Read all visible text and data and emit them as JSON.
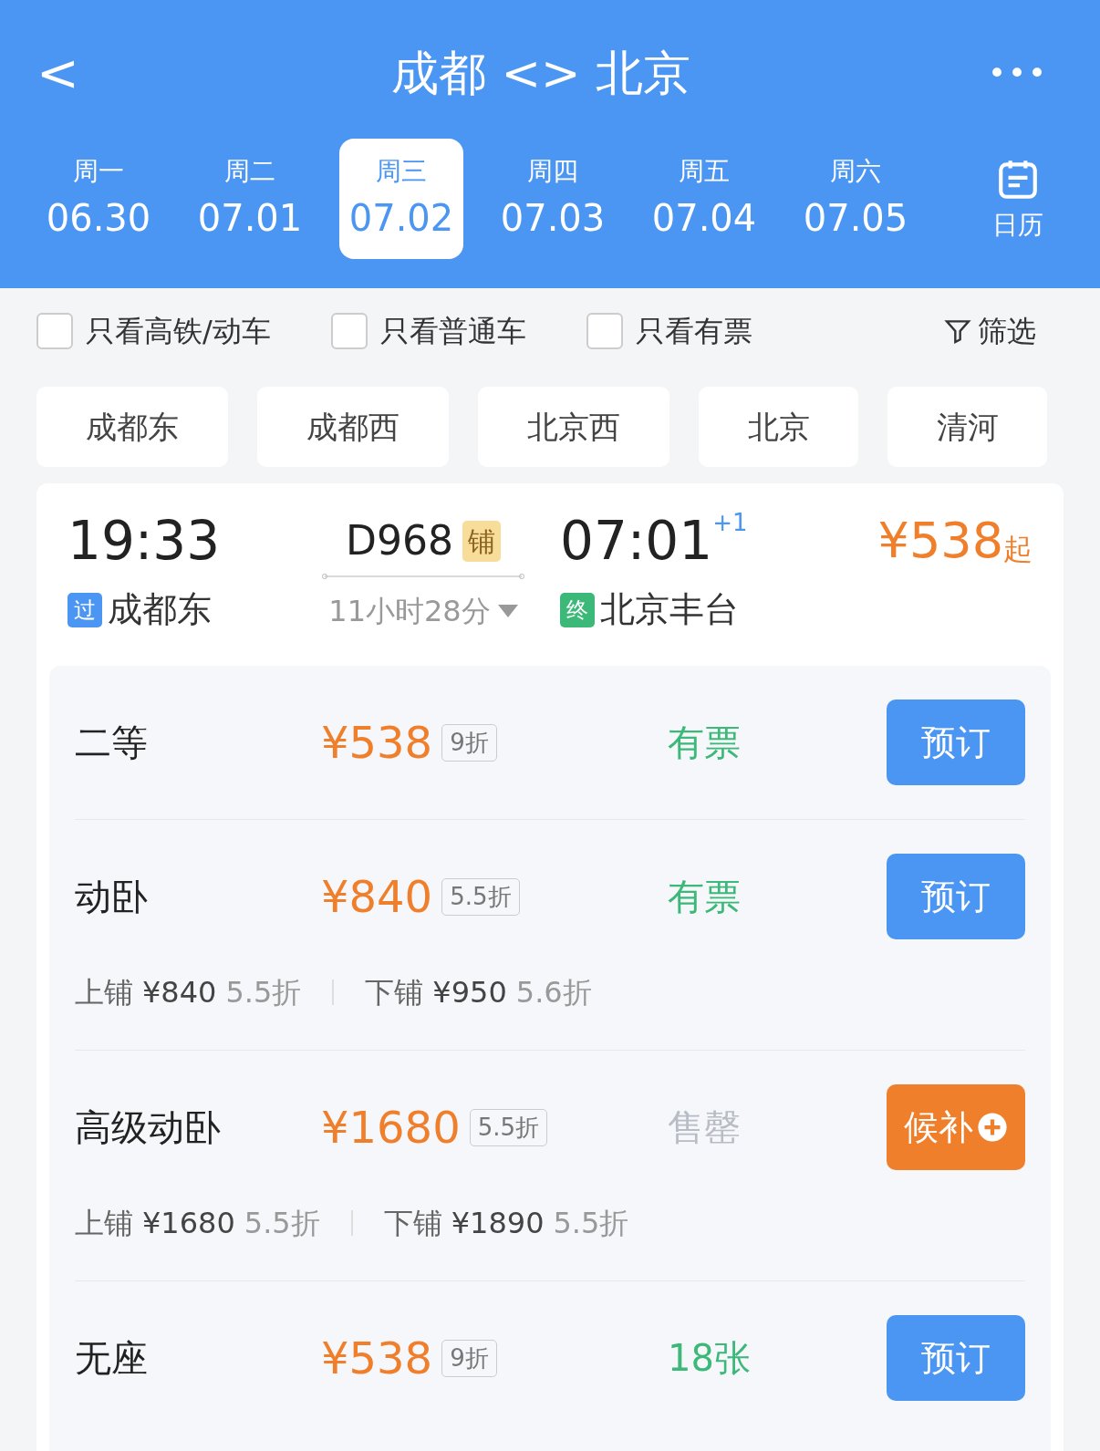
{
  "header": {
    "back": "<",
    "title": "成都 <> 北京",
    "more": "•••"
  },
  "dates": [
    {
      "day": "周一",
      "date": "06.30",
      "selected": false
    },
    {
      "day": "周二",
      "date": "07.01",
      "selected": false
    },
    {
      "day": "周三",
      "date": "07.02",
      "selected": true
    },
    {
      "day": "周四",
      "date": "07.03",
      "selected": false
    },
    {
      "day": "周五",
      "date": "07.04",
      "selected": false
    },
    {
      "day": "周六",
      "date": "07.05",
      "selected": false
    }
  ],
  "calendar": {
    "label": "日历"
  },
  "filters": [
    {
      "label": "只看高铁/动车",
      "checked": false
    },
    {
      "label": "只看普通车",
      "checked": false
    },
    {
      "label": "只看有票",
      "checked": false
    }
  ],
  "filter_button": "筛选",
  "stations": [
    {
      "label": "成都东",
      "selected": false
    },
    {
      "label": "成都西",
      "selected": false
    },
    {
      "label": "北京西",
      "selected": false
    },
    {
      "label": "北京",
      "selected": false
    },
    {
      "label": "清河",
      "selected": false
    }
  ],
  "train": {
    "depart_time": "19:33",
    "number": "D968",
    "type_badge": "铺",
    "arrive_time": "07:01",
    "day_offset": "+1",
    "price": "¥538",
    "price_suffix": "起",
    "depart_tag": "过",
    "depart_station": "成都东",
    "duration": "11小时28分",
    "arrive_tag": "终",
    "arrive_station": "北京丰台"
  },
  "seats": [
    {
      "name": "二等",
      "price": "¥538",
      "discount": "9折",
      "status": {
        "label": "有票",
        "kind": "available"
      },
      "action": {
        "label": "预订",
        "kind": "book"
      }
    },
    {
      "name": "动卧",
      "price": "¥840",
      "discount": "5.5折",
      "status": {
        "label": "有票",
        "kind": "available"
      },
      "action": {
        "label": "预订",
        "kind": "book"
      },
      "berths": [
        {
          "label": "上铺",
          "price": "¥840",
          "discount": "5.5折"
        },
        {
          "label": "下铺",
          "price": "¥950",
          "discount": "5.6折"
        }
      ]
    },
    {
      "name": "高级动卧",
      "price": "¥1680",
      "discount": "5.5折",
      "status": {
        "label": "售罄",
        "kind": "soldout"
      },
      "action": {
        "label": "候补",
        "kind": "waitlist"
      },
      "berths": [
        {
          "label": "上铺",
          "price": "¥1680",
          "discount": "5.5折"
        },
        {
          "label": "下铺",
          "price": "¥1890",
          "discount": "5.5折"
        }
      ]
    },
    {
      "name": "无座",
      "price": "¥538",
      "discount": "9折",
      "status": {
        "label": "18张",
        "kind": "available"
      },
      "action": {
        "label": "预订",
        "kind": "book"
      }
    }
  ]
}
